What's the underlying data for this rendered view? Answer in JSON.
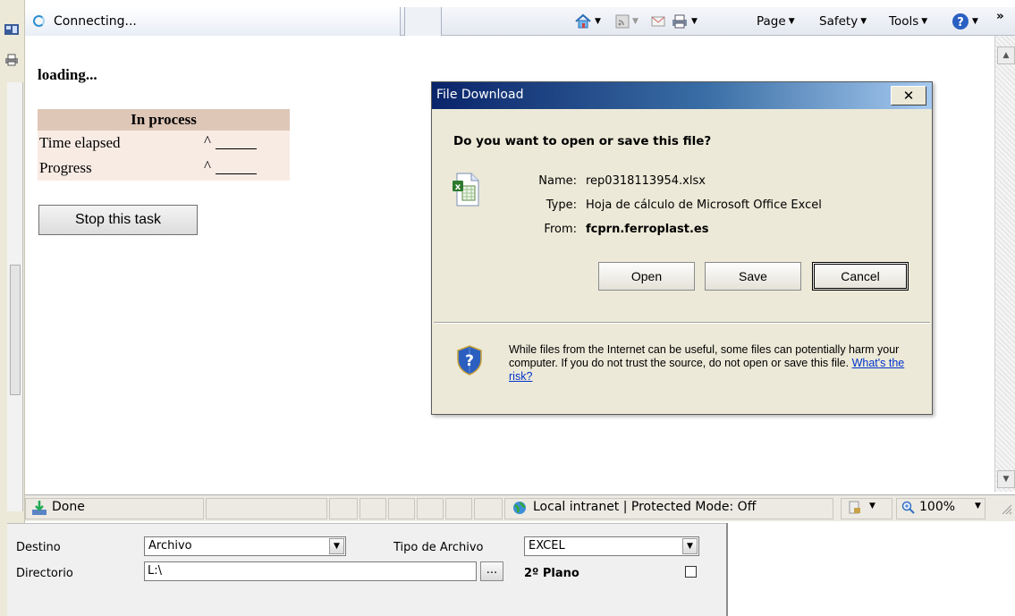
{
  "browser": {
    "tab_title": "Connecting...",
    "commands": {
      "page": "Page",
      "safety": "Safety",
      "tools": "Tools",
      "more": "»"
    }
  },
  "page": {
    "loading": "loading...",
    "table": {
      "header": "In process",
      "rows": [
        {
          "label": "Time elapsed",
          "value": "^"
        },
        {
          "label": "Progress",
          "value": "^"
        }
      ]
    },
    "stop_button": "Stop this task"
  },
  "dialog": {
    "title": "File Download",
    "close": "✕",
    "question": "Do you want to open or save this file?",
    "name_label": "Name:",
    "name_value": "rep0318113954.xlsx",
    "type_label": "Type:",
    "type_value": "Hoja de cálculo de Microsoft Office Excel",
    "from_label": "From:",
    "from_value": "fcprn.ferroplast.es",
    "buttons": {
      "open": "Open",
      "save": "Save",
      "cancel": "Cancel"
    },
    "warning": "While files from the Internet can be useful, some files can potentially harm your computer. If you do not trust the source, do not open or save this file.",
    "risk_link": "What's the risk?"
  },
  "statusbar": {
    "status": "Done",
    "zone": "Local intranet | Protected Mode: Off",
    "zoom": "100%"
  },
  "form": {
    "destino_label": "Destino",
    "destino_value": "Archivo",
    "tipo_label": "Tipo de Archivo",
    "tipo_value": "EXCEL",
    "directorio_label": "Directorio",
    "directorio_value": "L:\\",
    "browse_button": "...",
    "plano_label": "2º Plano"
  },
  "colors": {
    "title_bar": "#0a246a",
    "table_header": "#dfc7b8",
    "table_row": "#f8ebe4",
    "link": "#0033cc"
  }
}
